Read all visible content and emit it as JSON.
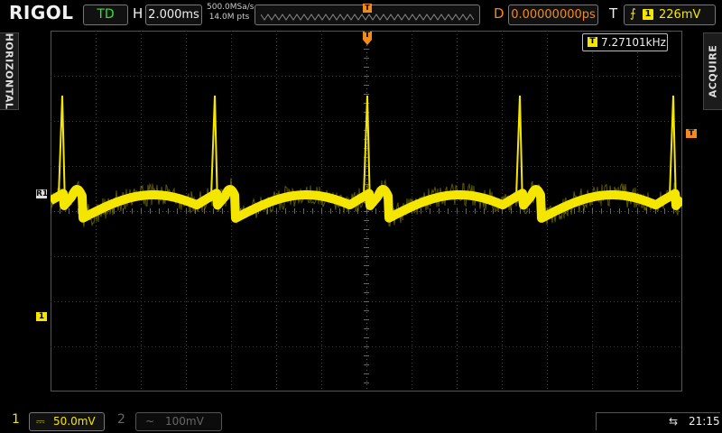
{
  "brand": "RIGOL",
  "header": {
    "run_status": "TD",
    "h_label": "H",
    "timebase": "2.000ms",
    "sample_rate": "500.0MSa/s",
    "memory_depth": "14.0M pts",
    "delay_label": "D",
    "delay": "0.00000000ps",
    "trigger_label": "T",
    "trigger_edge_icon": "rising-edge-icon",
    "trigger_source": "1",
    "trigger_level": "226mV"
  },
  "side_tabs": {
    "left": "HORIZONTAL",
    "right": "ACQUIRE"
  },
  "measurement": {
    "badge": "T",
    "frequency": "7.27101kHz"
  },
  "markers": {
    "trigger_pos": "T",
    "trigger_level": "T",
    "ref": "R1",
    "ch1": "1"
  },
  "channels": {
    "ch1": {
      "num": "1",
      "coupling": "⎓",
      "scale": "50.0mV",
      "color": "#f5e600"
    },
    "ch2": {
      "num": "2",
      "coupling": "~",
      "scale": "100mV",
      "color": "#666666"
    }
  },
  "status": {
    "usb_icon": "usb-icon",
    "time": "21:15"
  },
  "colors": {
    "trace": "#f5e600",
    "trigger": "#f28b1c",
    "run": "#35e13a"
  }
}
